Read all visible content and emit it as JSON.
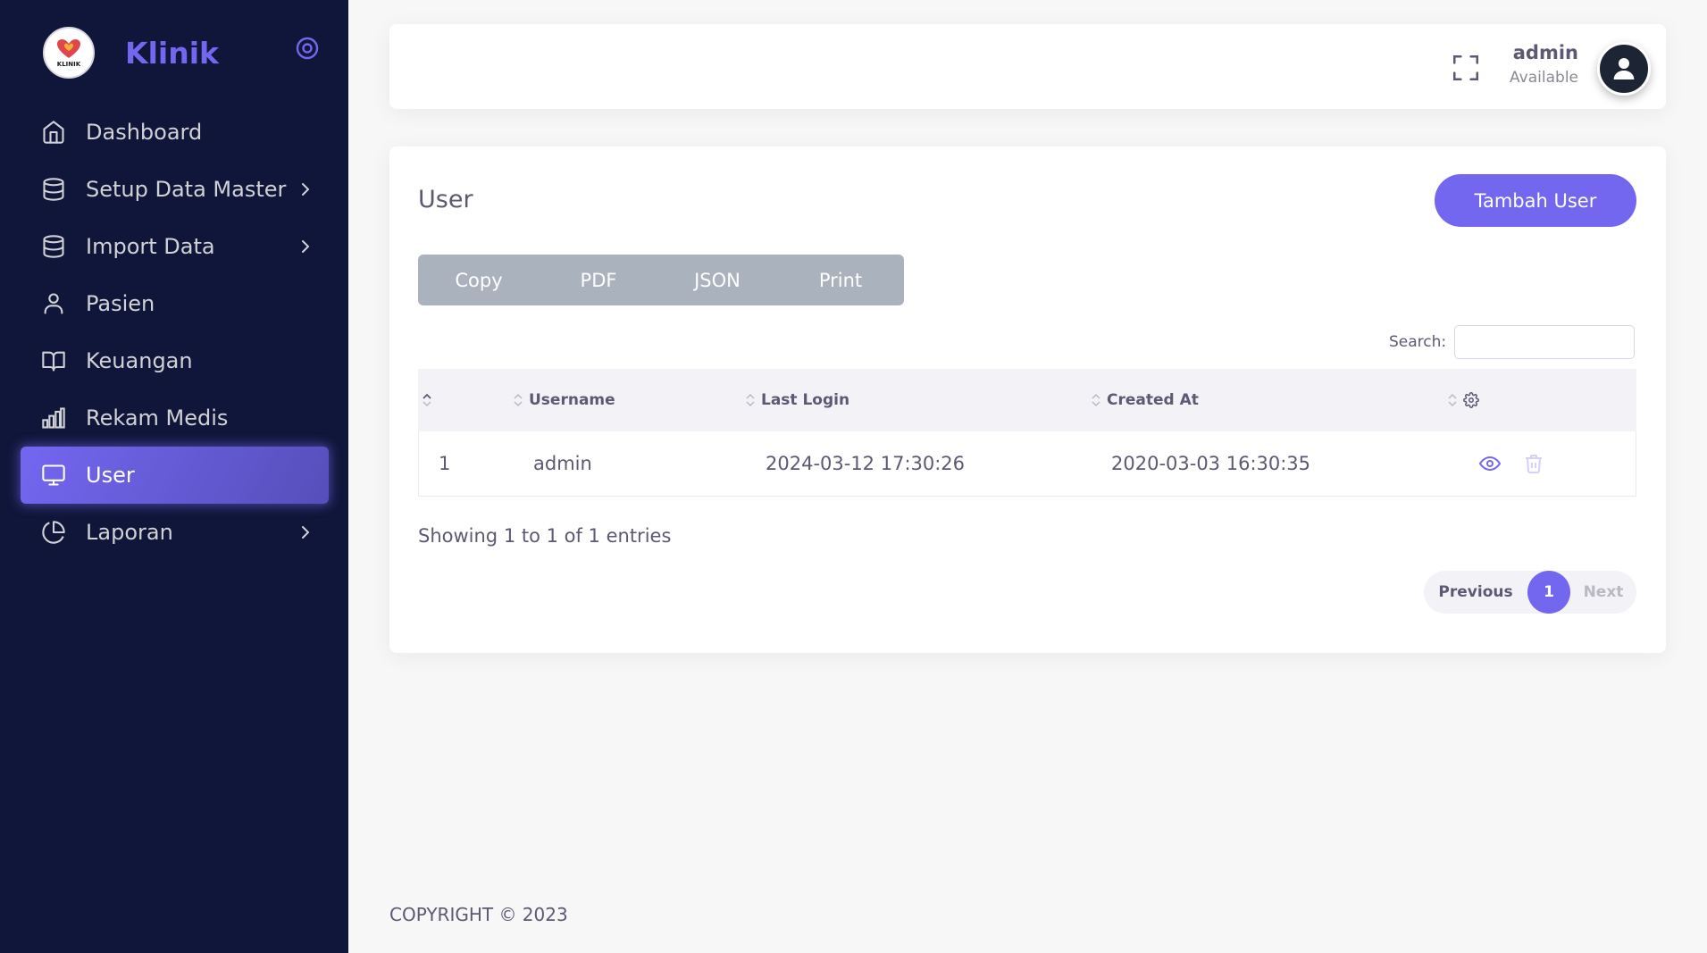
{
  "brand": {
    "name": "Klinik",
    "logo_text": "KLINIK"
  },
  "sidebar": {
    "items": [
      {
        "label": "Dashboard"
      },
      {
        "label": "Setup Data Master"
      },
      {
        "label": "Import Data"
      },
      {
        "label": "Pasien"
      },
      {
        "label": "Keuangan"
      },
      {
        "label": "Rekam Medis"
      },
      {
        "label": "User"
      },
      {
        "label": "Laporan"
      }
    ],
    "active": "User"
  },
  "header": {
    "user_name": "admin",
    "user_status": "Available"
  },
  "page": {
    "title": "User",
    "add_button": "Tambah User",
    "export_buttons": [
      "Copy",
      "PDF",
      "JSON",
      "Print"
    ],
    "search_label": "Search:",
    "search_value": ""
  },
  "table": {
    "columns": [
      "",
      "Username",
      "Last Login",
      "Created At"
    ],
    "rows": [
      {
        "no": "1",
        "username": "admin",
        "last_login": "2024-03-12 17:30:26",
        "created_at": "2020-03-03 16:30:35"
      }
    ],
    "info": "Showing 1 to 1 of 1 entries"
  },
  "pagination": {
    "previous": "Previous",
    "current": "1",
    "next": "Next"
  },
  "footer": {
    "copyright": "COPYRIGHT © 2023"
  },
  "colors": {
    "accent": "#7367f0",
    "sidebar_bg": "#10163a",
    "danger": "#ea5455"
  }
}
